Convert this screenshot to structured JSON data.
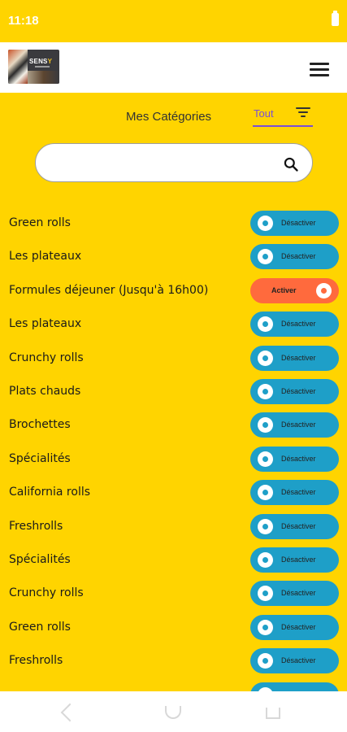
{
  "status_bar": {
    "time": "11:18"
  },
  "header": {
    "logo_text_main": "SENS",
    "logo_text_accent": "Y",
    "menu_icon": "hamburger-menu-icon"
  },
  "page": {
    "title": "Mes Catégories"
  },
  "filter": {
    "value": "Tout",
    "icon": "filter-list-icon"
  },
  "search": {
    "placeholder": "",
    "value": "",
    "icon": "search-icon"
  },
  "colors": {
    "background": "#ffd400",
    "toggle_active": "#1e9fc8",
    "toggle_inactive": "#ff6a3d",
    "filter_accent": "#7a4fd6"
  },
  "categories": [
    {
      "name": "Green rolls",
      "state": "on",
      "action": "Désactiver"
    },
    {
      "name": "Les plateaux",
      "state": "on",
      "action": "Désactiver"
    },
    {
      "name": "Formules déjeuner (Jusqu'à 16h00)",
      "state": "off",
      "action": "Activer"
    },
    {
      "name": "Les plateaux",
      "state": "on",
      "action": "Désactiver"
    },
    {
      "name": "Crunchy rolls",
      "state": "on",
      "action": "Désactiver"
    },
    {
      "name": "Plats chauds",
      "state": "on",
      "action": "Désactiver"
    },
    {
      "name": "Brochettes",
      "state": "on",
      "action": "Désactiver"
    },
    {
      "name": "Spécialités",
      "state": "on",
      "action": "Désactiver"
    },
    {
      "name": "California rolls",
      "state": "on",
      "action": "Désactiver"
    },
    {
      "name": "Freshrolls",
      "state": "on",
      "action": "Désactiver"
    },
    {
      "name": "Spécialités",
      "state": "on",
      "action": "Désactiver"
    },
    {
      "name": "Crunchy rolls",
      "state": "on",
      "action": "Désactiver"
    },
    {
      "name": "Green rolls",
      "state": "on",
      "action": "Désactiver"
    },
    {
      "name": "Freshrolls",
      "state": "on",
      "action": "Désactiver"
    },
    {
      "name": "",
      "state": "on",
      "action": ""
    }
  ],
  "nav": {
    "back_icon": "back-icon",
    "home_icon": "home-icon",
    "recent_icon": "recent-apps-icon"
  }
}
